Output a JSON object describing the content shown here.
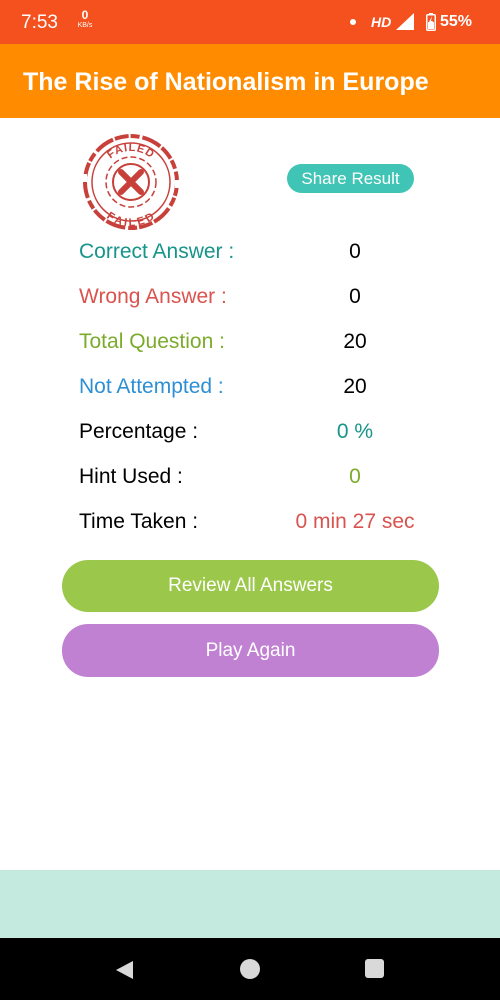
{
  "status_bar": {
    "time": "7:53",
    "net_speed_value": "0",
    "net_speed_unit": "KB/s",
    "network_type": "HD",
    "battery": "55%"
  },
  "header": {
    "title": "The Rise of Nationalism in Europe"
  },
  "result": {
    "stamp_text_top": "FAILED",
    "stamp_text_bottom": "FAILED",
    "share_label": "Share Result",
    "rows": [
      {
        "label": "Correct Answer :",
        "value": "0",
        "label_color": "#17958a",
        "value_color": "#000000"
      },
      {
        "label": "Wrong Answer :",
        "value": "0",
        "label_color": "#d9534f",
        "value_color": "#000000"
      },
      {
        "label": "Total Question :",
        "value": "20",
        "label_color": "#7cab2c",
        "value_color": "#000000"
      },
      {
        "label": "Not Attempted :",
        "value": "20",
        "label_color": "#2e8fd3",
        "value_color": "#000000"
      },
      {
        "label": "Percentage :",
        "value": "0  %",
        "label_color": "#000000",
        "value_color": "#17958a"
      },
      {
        "label": "Hint Used :",
        "value": "0",
        "label_color": "#000000",
        "value_color": "#7cab2c"
      },
      {
        "label": "Time Taken :",
        "value": "0 min 27 sec",
        "label_color": "#000000",
        "value_color": "#d9534f"
      }
    ]
  },
  "actions": {
    "review_label": "Review All Answers",
    "play_again_label": "Play Again"
  },
  "colors": {
    "status_bar": "#f4511e",
    "app_bar": "#ff8c00",
    "share_button": "#3fc4b5",
    "review_button": "#9bc74b",
    "play_button": "#c081d3",
    "bottom_panel": "#c4eadf",
    "stamp": "#c8403a"
  },
  "nav": {
    "icons": [
      "back-icon",
      "home-icon",
      "recents-icon"
    ]
  }
}
